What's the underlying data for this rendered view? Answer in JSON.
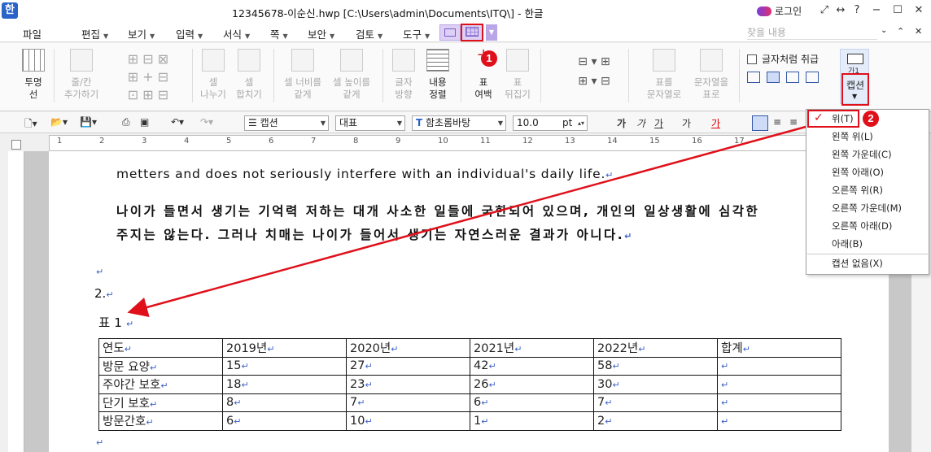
{
  "title": "12345678-이순신.hwp [C:\\Users\\admin\\Documents\\ITQ\\] - 한글",
  "app_logo": "한",
  "login": "로그인",
  "menu": [
    "파일",
    "편집",
    "보기",
    "입력",
    "서식",
    "쪽",
    "보안",
    "검토",
    "도구"
  ],
  "search_placeholder": "찾을 내용",
  "ribbon": {
    "transparent": "투명\n선",
    "row_col_add": "줄/칸\n추가하기",
    "cell_split": "셀\n나누기",
    "cell_merge": "셀\n합치기",
    "cell_width": "셀 너비를\n같게",
    "cell_height": "셀 높이를\n같게",
    "text_dir": "글자\n방향",
    "content_align": "내용\n정렬",
    "table_margin": "표\n여백",
    "table_flip": "표\n뒤집기",
    "table_to_text": "표를\n문자열로",
    "text_to_table": "문자열을\n표로",
    "treat_as_char": "글자처럼 취급",
    "caption": "캡션",
    "caption_icon_label": "가1"
  },
  "format": {
    "style": "캡션",
    "lang": "대표",
    "font": "함초롬바탕",
    "size": "10.0",
    "unit": "pt",
    "bold": "가",
    "italic": "가",
    "underline": "가",
    "strike": "가",
    "color": "가"
  },
  "doc": {
    "line1": "metters and does not seriously interfere with an individual's daily life.",
    "line2": "나이가 들면서 생기는 기억력 저하는 대개 사소한 일들에 국한되어 있으며, 개인의 일상생활에 심각한",
    "line3": "주지는 않는다. 그러나 치매는 나이가 들어서 생기는 자연스러운 결과가 아니다.",
    "num": "2.",
    "caption": "표 1",
    "table": {
      "rows": [
        [
          "연도",
          "2019년",
          "2020년",
          "2021년",
          "2022년",
          "합계"
        ],
        [
          "방문 요양",
          "15",
          "27",
          "42",
          "58",
          ""
        ],
        [
          "주야간 보호",
          "18",
          "23",
          "26",
          "30",
          ""
        ],
        [
          "단기 보호",
          "8",
          "7",
          "6",
          "7",
          ""
        ],
        [
          "방문간호",
          "6",
          "10",
          "1",
          "2",
          ""
        ]
      ]
    }
  },
  "caption_menu": [
    "위(T)",
    "왼쪽 위(L)",
    "왼쪽 가운데(C)",
    "왼쪽 아래(O)",
    "오른쪽 위(R)",
    "오른쪽 가운데(M)",
    "오른쪽 아래(D)",
    "아래(B)",
    "캡션 없음(X)"
  ],
  "badges": [
    "1",
    "2"
  ],
  "ruler_numbers": [
    "1",
    "2",
    "3",
    "4",
    "5",
    "6",
    "7",
    "8",
    "9",
    "10",
    "11",
    "12",
    "13",
    "14",
    "15",
    "16",
    "17"
  ],
  "colors": {
    "accent": "#e0101a",
    "return_mark": "#3a5fc8"
  }
}
